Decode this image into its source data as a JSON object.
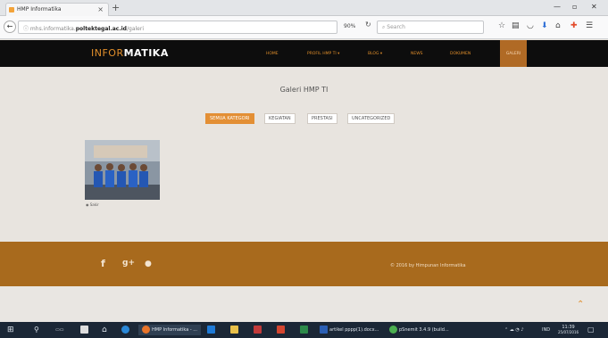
{
  "browser": {
    "tab_title": "HMP Informatika",
    "tab_close": "×",
    "new_tab": "+",
    "back_icon": "←",
    "url_prefix": "mhs.informatika.",
    "url_domain": "poltektegal.ac.id",
    "url_suffix": "/galeri",
    "zoom": "90%",
    "reload_icon": "↻",
    "search_placeholder": "Search",
    "search_icon": "⌕",
    "window_min": "—",
    "window_max": "▫",
    "window_close": "✕"
  },
  "site": {
    "logo_light": "INFOR",
    "logo_bold": "MATIKA",
    "nav": [
      {
        "label": "HOME"
      },
      {
        "label": "PROFIL HMP TI ▾"
      },
      {
        "label": "BLOG ▾"
      },
      {
        "label": "NEWS"
      },
      {
        "label": "DOKUMEN"
      },
      {
        "label": "GALERI"
      }
    ]
  },
  "content": {
    "title": "Galeri HMP TI",
    "filters": [
      {
        "label": "SEMUA KATEGORI",
        "active": true
      },
      {
        "label": "KEGIATAN",
        "active": false
      },
      {
        "label": "PRESTASI",
        "active": false
      },
      {
        "label": "UNCATEGORIZED",
        "active": false
      }
    ],
    "gallery": [
      {
        "caption": "Sakir"
      }
    ]
  },
  "footer": {
    "copyright": "© 2016 by Himpunan Informatika",
    "social": [
      {
        "icon": "facebook-icon",
        "glyph": "f"
      },
      {
        "icon": "google-plus-icon",
        "glyph": "g+"
      },
      {
        "icon": "chat-icon",
        "glyph": "●"
      }
    ],
    "back_to_top": "⌃"
  },
  "taskbar": {
    "apps": [
      {
        "label": "HMP Informatika - ..."
      },
      {
        "label": "artikel pppp(1).docx..."
      },
      {
        "label": "pSnemit 3.4.9 (build..."
      }
    ],
    "lang": "IND",
    "time": "11:39",
    "date": "25/07/2016"
  },
  "colors": {
    "accent": "#e08e2b",
    "nav_bg": "#0d0d0d",
    "footer_bg": "#a86a1d",
    "page_bg": "#e8e4df"
  }
}
